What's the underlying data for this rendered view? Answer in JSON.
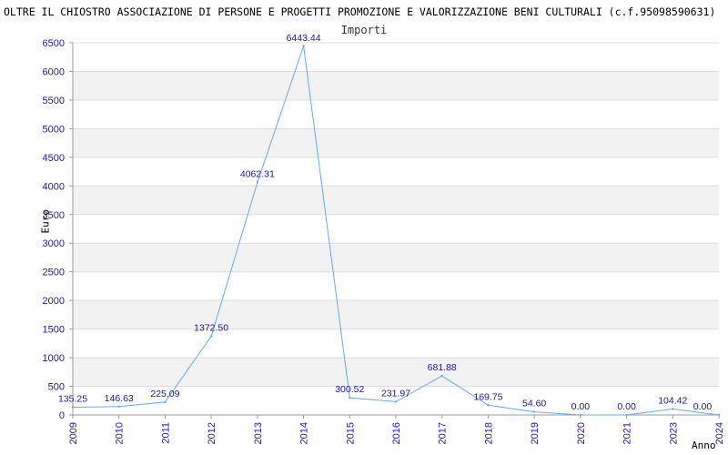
{
  "chart_data": {
    "type": "line",
    "title": "OLTRE IL CHIOSTRO ASSOCIAZIONE DI PERSONE E PROGETTI PROMOZIONE E VALORIZZAZIONE BENI CULTURALI (c.f.95098590631)",
    "subtitle": "Importi",
    "xlabel": "Anno",
    "ylabel": "Euro",
    "ylim": [
      0,
      6500
    ],
    "yticks": [
      0,
      500,
      1000,
      1500,
      2000,
      2500,
      3000,
      3500,
      4000,
      4500,
      5000,
      5500,
      6000,
      6500
    ],
    "x": [
      "2009",
      "2010",
      "2011",
      "2012",
      "2013",
      "2014",
      "2015",
      "2016",
      "2017",
      "2018",
      "2019",
      "2020",
      "2021",
      "2023",
      "2024"
    ],
    "values": [
      135.25,
      146.63,
      225.09,
      1372.5,
      4062.31,
      6443.44,
      300.52,
      231.97,
      681.88,
      169.75,
      54.6,
      0.0,
      0.0,
      104.42,
      0.0
    ],
    "labels": [
      "135.25",
      "146.63",
      "225.09",
      "1372.50",
      "4062.31",
      "6443.44",
      "300.52",
      "231.97",
      "681.88",
      "169.75",
      "54.60",
      "0.00",
      "0.00",
      "104.42",
      "0.00"
    ],
    "grid": true,
    "line_color": "#66aaee",
    "band_color": "#f2f2f2",
    "text_color": "#1a1aa6"
  }
}
